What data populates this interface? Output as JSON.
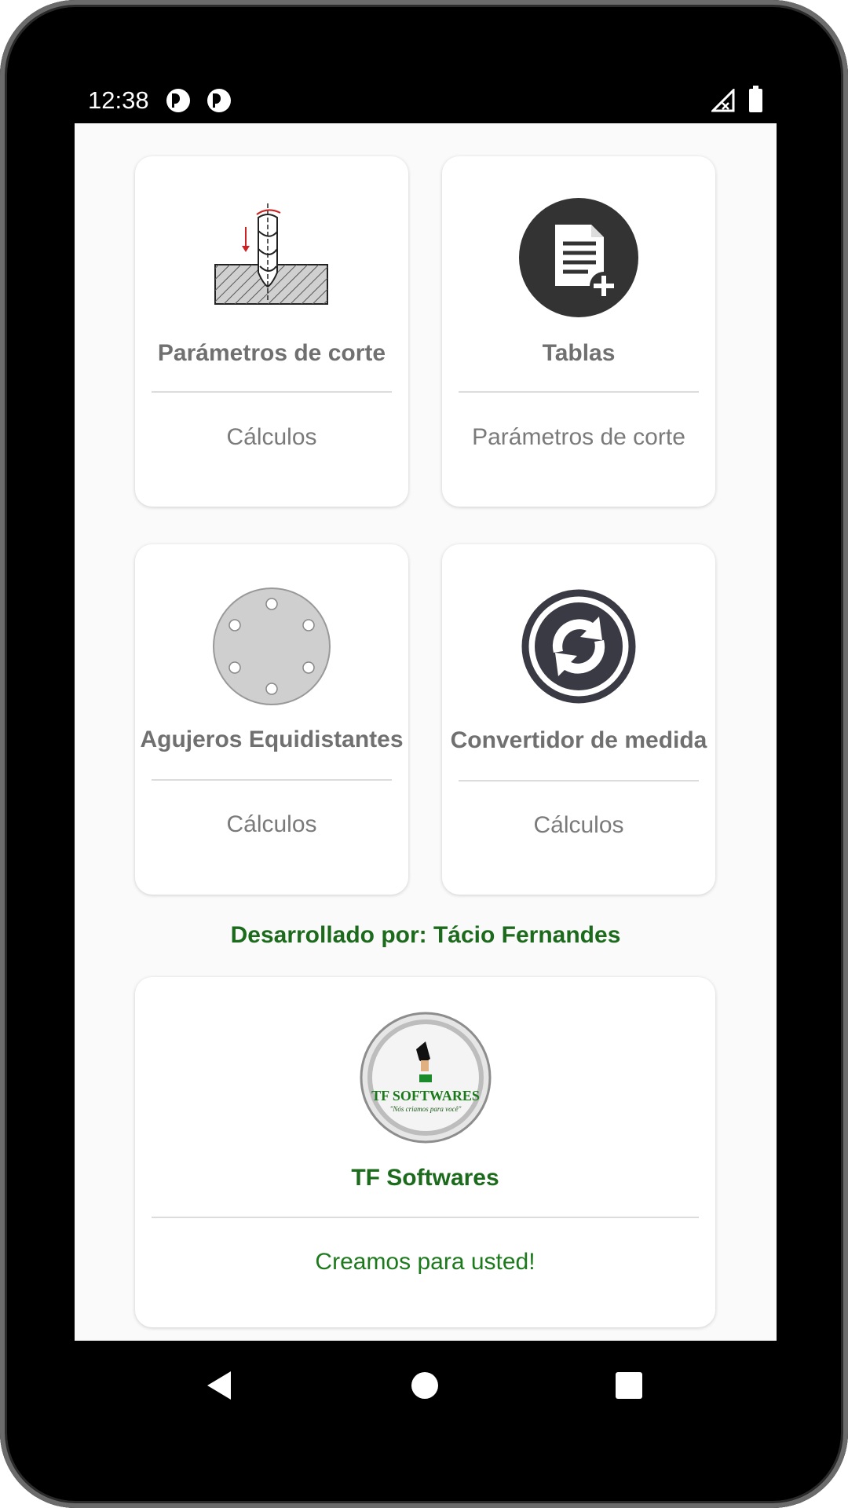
{
  "status_bar": {
    "time": "12:38"
  },
  "cards": [
    {
      "title": "Parámetros de corte",
      "subtitle": "Cálculos",
      "icon": "drill-icon"
    },
    {
      "title": "Tablas",
      "subtitle": "Parámetros de corte",
      "icon": "document-add-icon"
    },
    {
      "title": "Agujeros Equidistantes",
      "subtitle": "Cálculos",
      "icon": "hole-circle-icon"
    },
    {
      "title": "Convertidor de medida",
      "subtitle": "Cálculos",
      "icon": "convert-icon"
    }
  ],
  "developer": {
    "label": "Desarrollado por: Tácio Fernandes"
  },
  "company_card": {
    "logo_text": "TF SOFTWARES",
    "logo_tagline": "\"Nós criamos para você\"",
    "title": "TF Softwares",
    "subtitle": "Creamos para usted!"
  },
  "colors": {
    "accent_green": "#1c6b1c",
    "card_text": "#707070",
    "icon_dark": "#333333"
  }
}
